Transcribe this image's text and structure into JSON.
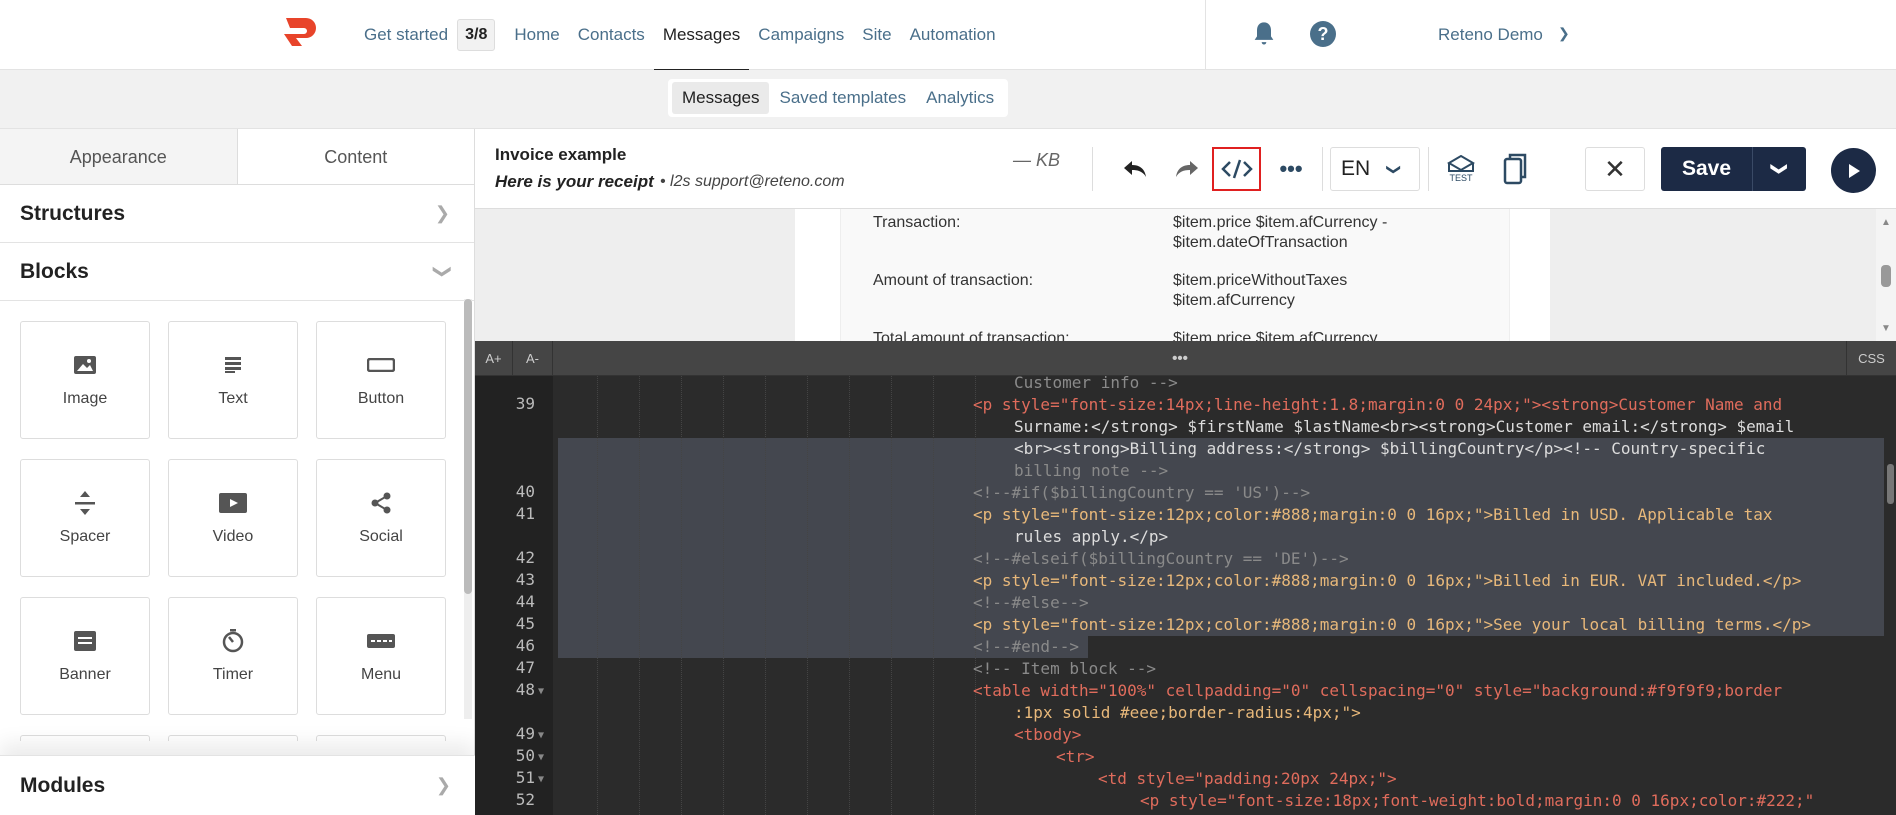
{
  "nav": {
    "get_started": "Get started",
    "progress": "3/8",
    "home": "Home",
    "contacts": "Contacts",
    "messages": "Messages",
    "campaigns": "Campaigns",
    "site": "Site",
    "automation": "Automation",
    "user": "Reteno Demo"
  },
  "subnav": {
    "messages": "Messages",
    "saved_templates": "Saved templates",
    "analytics": "Analytics"
  },
  "left_panel": {
    "tab_appearance": "Appearance",
    "tab_content": "Content",
    "structures": "Structures",
    "blocks_title": "Blocks",
    "modules": "Modules",
    "blocks": [
      "Image",
      "Text",
      "Button",
      "Spacer",
      "Video",
      "Social",
      "Banner",
      "Timer",
      "Menu"
    ]
  },
  "editor": {
    "title": "Invoice example",
    "subject": "Here is your receipt",
    "sender": "• l2s support@reteno.com",
    "size": "— KB",
    "language": "EN",
    "test_label": "TEST",
    "save": "Save"
  },
  "preview": {
    "rows": [
      {
        "label": "Transaction:",
        "value1": "$item.price $item.afCurrency -",
        "value2": "$item.dateOfTransaction"
      },
      {
        "label": "Amount of transaction:",
        "value1": "$item.priceWithoutTaxes",
        "value2": "$item.afCurrency"
      },
      {
        "label": "Total amount of transaction:",
        "value1": "$item.price $item.afCurrency",
        "value2": ""
      }
    ]
  },
  "code_toolbar": {
    "font_up": "A+",
    "font_down": "A-",
    "handle": "•••",
    "css": "CSS"
  },
  "code": {
    "line_numbers": [
      "39",
      "40",
      "41",
      "42",
      "43",
      "44",
      "45",
      "46",
      "47",
      "48",
      "49",
      "50",
      "51",
      "52"
    ],
    "lines": [
      "Customer info -->",
      "<p style=\"font-size:14px;line-height:1.8;margin:0 0 24px;\"><strong>Customer Name and",
      "Surname:</strong> $firstName $lastName<br><strong>Customer email:</strong> $email",
      "<br><strong>Billing address:</strong> $billingCountry</p><!-- Country-specific",
      "billing note -->",
      "<!--#if($billingCountry == 'US')-->",
      "<p style=\"font-size:12px;color:#888;margin:0 0 16px;\">Billed in USD. Applicable tax",
      "rules apply.</p>",
      "<!--#elseif($billingCountry == 'DE')-->",
      "<p style=\"font-size:12px;color:#888;margin:0 0 16px;\">Billed in EUR. VAT included.</p>",
      "<!--#else-->",
      "<p style=\"font-size:12px;color:#888;margin:0 0 16px;\">See your local billing terms.</p>",
      "<!--#end-->",
      "<!-- Item block -->",
      "<table width=\"100%\" cellpadding=\"0\" cellspacing=\"0\" style=\"background:#f9f9f9;border",
      ":1px solid #eee;border-radius:4px;\">",
      "<tbody>",
      "<tr>",
      "<td style=\"padding:20px 24px;\">",
      "<p style=\"font-size:18px;font-weight:bold;margin:0 0 16px;color:#222;\""
    ]
  },
  "colors": {
    "accent_red": "#e8442a",
    "navy": "#1c2a45",
    "link": "#4a6f8a"
  }
}
